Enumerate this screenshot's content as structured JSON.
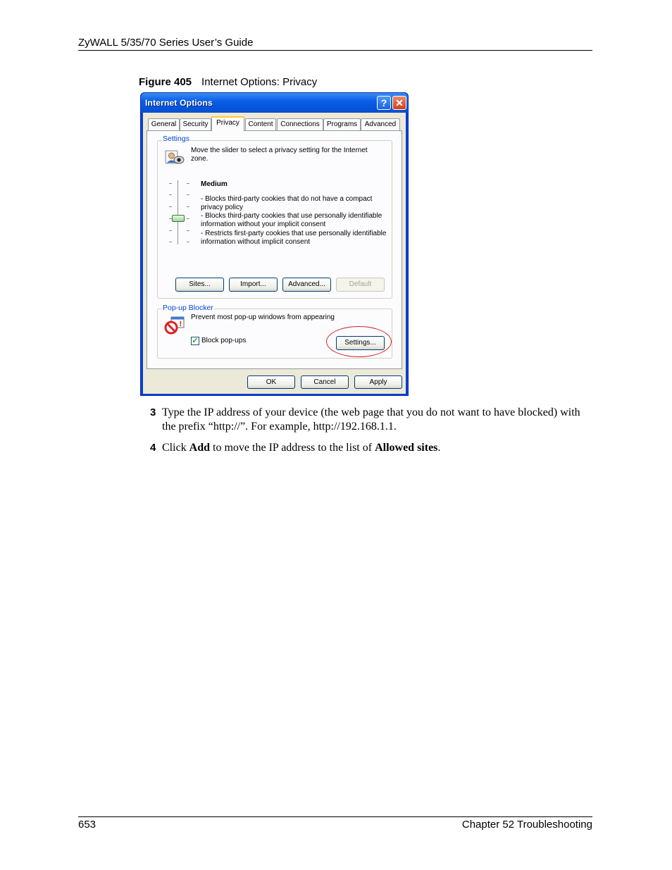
{
  "header": {
    "title": "ZyWALL 5/35/70 Series User’s Guide"
  },
  "figure": {
    "label": "Figure 405",
    "caption": "Internet Options: Privacy"
  },
  "dialog": {
    "title": "Internet Options",
    "help_glyph": "?",
    "close_glyph": "✕",
    "tabs": [
      "General",
      "Security",
      "Privacy",
      "Content",
      "Connections",
      "Programs",
      "Advanced"
    ],
    "active_tab": "Privacy",
    "settings": {
      "group_label": "Settings",
      "intro": "Move the slider to select a privacy setting for the Internet zone.",
      "level": "Medium",
      "descriptions": [
        "- Blocks third-party cookies that do not have a compact privacy policy",
        "- Blocks third-party cookies that use personally identifiable information without your implicit consent",
        "- Restricts first-party cookies that use personally identifiable information without implicit consent"
      ],
      "buttons": {
        "sites": "Sites...",
        "import": "Import...",
        "advanced": "Advanced...",
        "default": "Default"
      }
    },
    "popup": {
      "group_label": "Pop-up Blocker",
      "description": "Prevent most pop-up windows from appearing",
      "checkbox_label": "Block pop-ups",
      "checkbox_checked": true,
      "settings_button": "Settings..."
    },
    "footer_buttons": {
      "ok": "OK",
      "cancel": "Cancel",
      "apply": "Apply"
    }
  },
  "steps": [
    {
      "number": "3",
      "text_html": "Type the IP address of your device (the web page that you do not want to have blocked) with the prefix “http://”. For example, http://192.168.1.1."
    },
    {
      "number": "4",
      "prefix": "Click ",
      "bold1": "Add",
      "middle": " to move the IP address to the list of ",
      "bold2": "Allowed sites",
      "suffix": "."
    }
  ],
  "footer": {
    "page_number": "653",
    "chapter": "Chapter 52 Troubleshooting"
  }
}
